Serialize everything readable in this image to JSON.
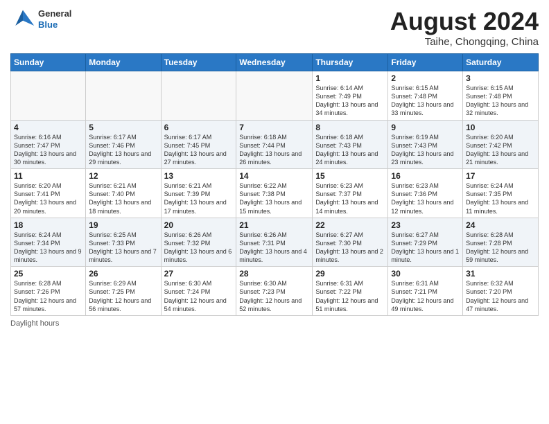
{
  "header": {
    "logo_general": "General",
    "logo_blue": "Blue",
    "title": "August 2024",
    "location": "Taihe, Chongqing, China"
  },
  "days_of_week": [
    "Sunday",
    "Monday",
    "Tuesday",
    "Wednesday",
    "Thursday",
    "Friday",
    "Saturday"
  ],
  "weeks": [
    [
      {
        "day": "",
        "empty": true
      },
      {
        "day": "",
        "empty": true
      },
      {
        "day": "",
        "empty": true
      },
      {
        "day": "",
        "empty": true
      },
      {
        "day": "1",
        "sunrise": "6:14 AM",
        "sunset": "7:49 PM",
        "daylight": "13 hours and 34 minutes."
      },
      {
        "day": "2",
        "sunrise": "6:15 AM",
        "sunset": "7:48 PM",
        "daylight": "13 hours and 33 minutes."
      },
      {
        "day": "3",
        "sunrise": "6:15 AM",
        "sunset": "7:48 PM",
        "daylight": "13 hours and 32 minutes."
      }
    ],
    [
      {
        "day": "4",
        "sunrise": "6:16 AM",
        "sunset": "7:47 PM",
        "daylight": "13 hours and 30 minutes."
      },
      {
        "day": "5",
        "sunrise": "6:17 AM",
        "sunset": "7:46 PM",
        "daylight": "13 hours and 29 minutes."
      },
      {
        "day": "6",
        "sunrise": "6:17 AM",
        "sunset": "7:45 PM",
        "daylight": "13 hours and 27 minutes."
      },
      {
        "day": "7",
        "sunrise": "6:18 AM",
        "sunset": "7:44 PM",
        "daylight": "13 hours and 26 minutes."
      },
      {
        "day": "8",
        "sunrise": "6:18 AM",
        "sunset": "7:43 PM",
        "daylight": "13 hours and 24 minutes."
      },
      {
        "day": "9",
        "sunrise": "6:19 AM",
        "sunset": "7:43 PM",
        "daylight": "13 hours and 23 minutes."
      },
      {
        "day": "10",
        "sunrise": "6:20 AM",
        "sunset": "7:42 PM",
        "daylight": "13 hours and 21 minutes."
      }
    ],
    [
      {
        "day": "11",
        "sunrise": "6:20 AM",
        "sunset": "7:41 PM",
        "daylight": "13 hours and 20 minutes."
      },
      {
        "day": "12",
        "sunrise": "6:21 AM",
        "sunset": "7:40 PM",
        "daylight": "13 hours and 18 minutes."
      },
      {
        "day": "13",
        "sunrise": "6:21 AM",
        "sunset": "7:39 PM",
        "daylight": "13 hours and 17 minutes."
      },
      {
        "day": "14",
        "sunrise": "6:22 AM",
        "sunset": "7:38 PM",
        "daylight": "13 hours and 15 minutes."
      },
      {
        "day": "15",
        "sunrise": "6:23 AM",
        "sunset": "7:37 PM",
        "daylight": "13 hours and 14 minutes."
      },
      {
        "day": "16",
        "sunrise": "6:23 AM",
        "sunset": "7:36 PM",
        "daylight": "13 hours and 12 minutes."
      },
      {
        "day": "17",
        "sunrise": "6:24 AM",
        "sunset": "7:35 PM",
        "daylight": "13 hours and 11 minutes."
      }
    ],
    [
      {
        "day": "18",
        "sunrise": "6:24 AM",
        "sunset": "7:34 PM",
        "daylight": "13 hours and 9 minutes."
      },
      {
        "day": "19",
        "sunrise": "6:25 AM",
        "sunset": "7:33 PM",
        "daylight": "13 hours and 7 minutes."
      },
      {
        "day": "20",
        "sunrise": "6:26 AM",
        "sunset": "7:32 PM",
        "daylight": "13 hours and 6 minutes."
      },
      {
        "day": "21",
        "sunrise": "6:26 AM",
        "sunset": "7:31 PM",
        "daylight": "13 hours and 4 minutes."
      },
      {
        "day": "22",
        "sunrise": "6:27 AM",
        "sunset": "7:30 PM",
        "daylight": "13 hours and 2 minutes."
      },
      {
        "day": "23",
        "sunrise": "6:27 AM",
        "sunset": "7:29 PM",
        "daylight": "13 hours and 1 minute."
      },
      {
        "day": "24",
        "sunrise": "6:28 AM",
        "sunset": "7:28 PM",
        "daylight": "12 hours and 59 minutes."
      }
    ],
    [
      {
        "day": "25",
        "sunrise": "6:28 AM",
        "sunset": "7:26 PM",
        "daylight": "12 hours and 57 minutes."
      },
      {
        "day": "26",
        "sunrise": "6:29 AM",
        "sunset": "7:25 PM",
        "daylight": "12 hours and 56 minutes."
      },
      {
        "day": "27",
        "sunrise": "6:30 AM",
        "sunset": "7:24 PM",
        "daylight": "12 hours and 54 minutes."
      },
      {
        "day": "28",
        "sunrise": "6:30 AM",
        "sunset": "7:23 PM",
        "daylight": "12 hours and 52 minutes."
      },
      {
        "day": "29",
        "sunrise": "6:31 AM",
        "sunset": "7:22 PM",
        "daylight": "12 hours and 51 minutes."
      },
      {
        "day": "30",
        "sunrise": "6:31 AM",
        "sunset": "7:21 PM",
        "daylight": "12 hours and 49 minutes."
      },
      {
        "day": "31",
        "sunrise": "6:32 AM",
        "sunset": "7:20 PM",
        "daylight": "12 hours and 47 minutes."
      }
    ]
  ],
  "footer": {
    "note": "Daylight hours"
  }
}
